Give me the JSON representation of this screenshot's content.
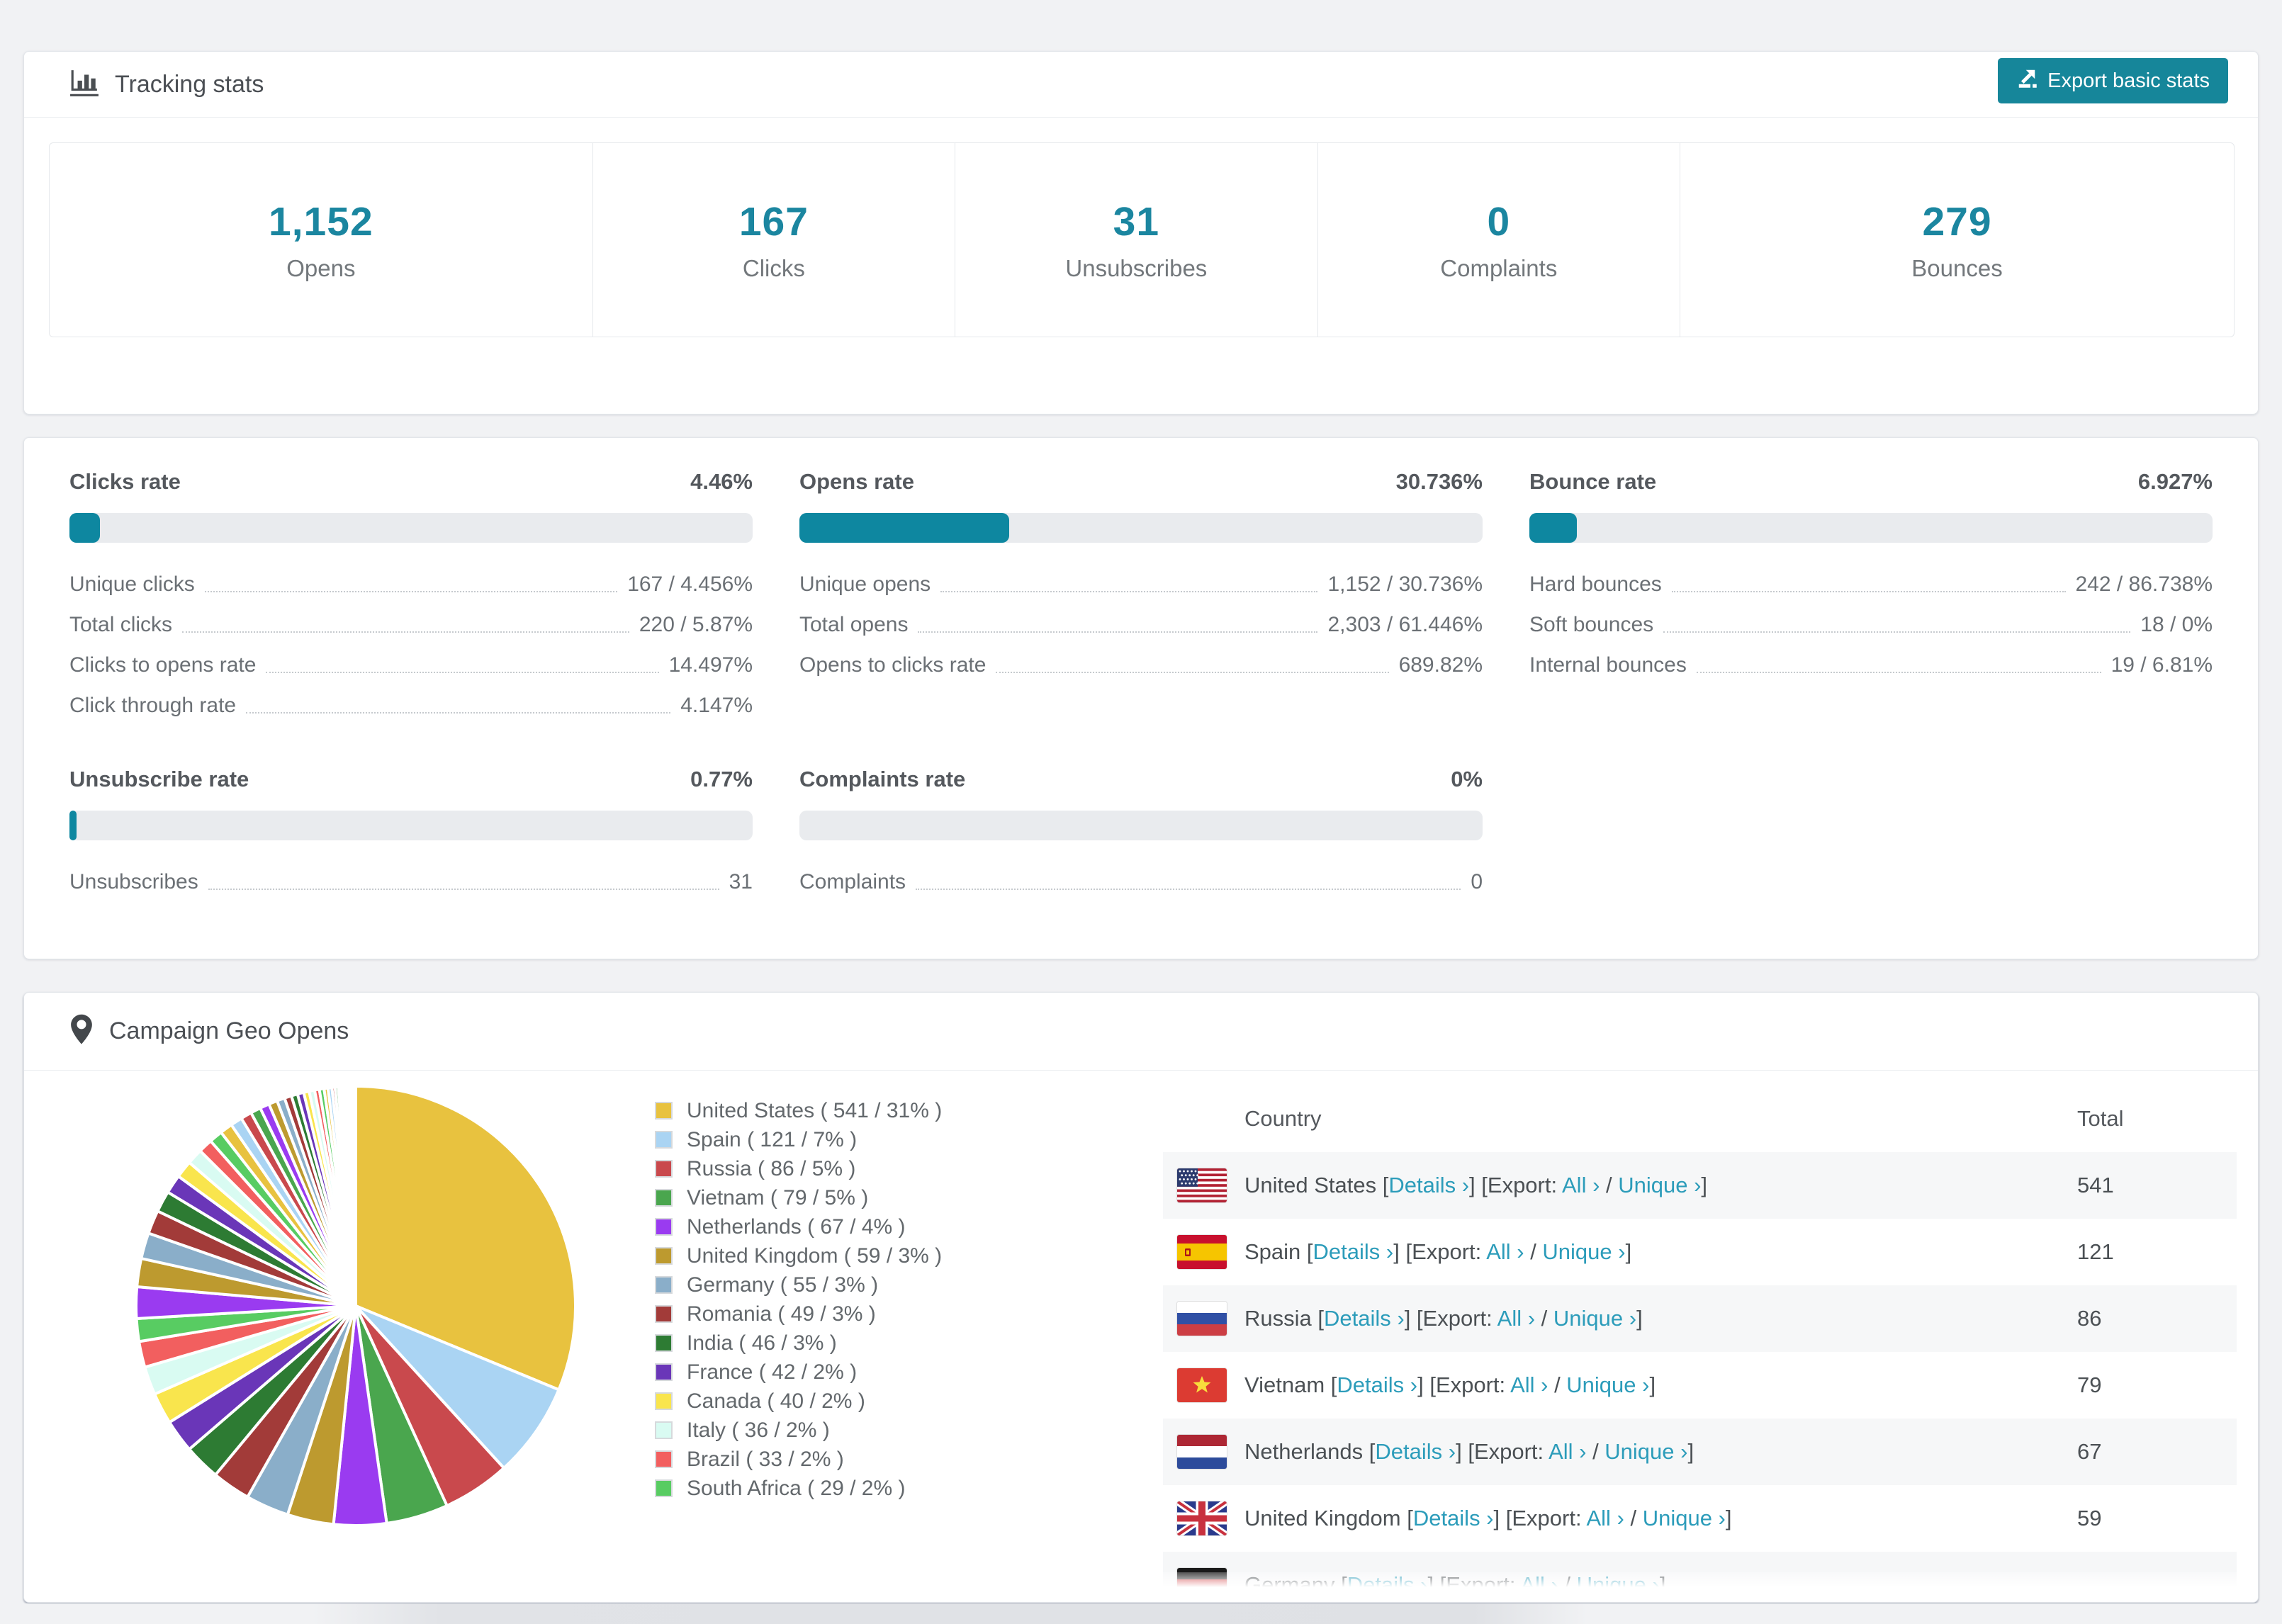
{
  "colors": {
    "accent": "#1b86a0",
    "accent_button": "#16869a",
    "bar_fill": "#0e87a0",
    "link": "#2c9cba"
  },
  "tracking": {
    "title": "Tracking stats",
    "export_button": "Export basic stats",
    "stats": [
      {
        "value": "1,152",
        "label": "Opens"
      },
      {
        "value": "167",
        "label": "Clicks"
      },
      {
        "value": "31",
        "label": "Unsubscribes"
      },
      {
        "value": "0",
        "label": "Complaints"
      },
      {
        "value": "279",
        "label": "Bounces"
      }
    ]
  },
  "rates": [
    {
      "title": "Clicks rate",
      "value": "4.46%",
      "bar_pct": 4.46,
      "rows": [
        {
          "label": "Unique clicks",
          "value": "167 / 4.456%"
        },
        {
          "label": "Total clicks",
          "value": "220 / 5.87%"
        },
        {
          "label": "Clicks to opens rate",
          "value": "14.497%"
        },
        {
          "label": "Click through rate",
          "value": "4.147%"
        }
      ]
    },
    {
      "title": "Opens rate",
      "value": "30.736%",
      "bar_pct": 30.736,
      "rows": [
        {
          "label": "Unique opens",
          "value": "1,152 / 30.736%"
        },
        {
          "label": "Total opens",
          "value": "2,303 / 61.446%"
        },
        {
          "label": "Opens to clicks rate",
          "value": "689.82%"
        }
      ]
    },
    {
      "title": "Bounce rate",
      "value": "6.927%",
      "bar_pct": 6.927,
      "rows": [
        {
          "label": "Hard bounces",
          "value": "242 / 86.738%"
        },
        {
          "label": "Soft bounces",
          "value": "18 / 0%"
        },
        {
          "label": "Internal bounces",
          "value": "19 / 6.81%"
        }
      ]
    },
    {
      "title": "Unsubscribe rate",
      "value": "0.77%",
      "bar_pct": 0.77,
      "rows": [
        {
          "label": "Unsubscribes",
          "value": "31"
        }
      ]
    },
    {
      "title": "Complaints rate",
      "value": "0%",
      "bar_pct": 0,
      "rows": [
        {
          "label": "Complaints",
          "value": "0"
        }
      ]
    }
  ],
  "geo": {
    "title": "Campaign Geo Opens",
    "table": {
      "headers": [
        "Country",
        "Total"
      ],
      "link_labels": {
        "details": "Details ›",
        "export_prefix": "Export:",
        "all": "All ›",
        "separator": "/",
        "unique": "Unique ›"
      },
      "rows": [
        {
          "country": "United States",
          "flag": "us",
          "total": "541"
        },
        {
          "country": "Spain",
          "flag": "es",
          "total": "121"
        },
        {
          "country": "Russia",
          "flag": "ru",
          "total": "86"
        },
        {
          "country": "Vietnam",
          "flag": "vn",
          "total": "79"
        },
        {
          "country": "Netherlands",
          "flag": "nl",
          "total": "67"
        },
        {
          "country": "United Kingdom",
          "flag": "gb",
          "total": "59"
        }
      ],
      "partial_row": {
        "country": "Germany",
        "flag": "de"
      }
    }
  },
  "chart_data": {
    "type": "pie",
    "title": "Campaign Geo Opens",
    "legend_position": "right",
    "series": [
      {
        "name": "United States",
        "value": 541,
        "pct": 31
      },
      {
        "name": "Spain",
        "value": 121,
        "pct": 7
      },
      {
        "name": "Russia",
        "value": 86,
        "pct": 5
      },
      {
        "name": "Vietnam",
        "value": 79,
        "pct": 5
      },
      {
        "name": "Netherlands",
        "value": 67,
        "pct": 4
      },
      {
        "name": "United Kingdom",
        "value": 59,
        "pct": 3
      },
      {
        "name": "Germany",
        "value": 55,
        "pct": 3
      },
      {
        "name": "Romania",
        "value": 49,
        "pct": 3
      },
      {
        "name": "India",
        "value": 46,
        "pct": 3
      },
      {
        "name": "France",
        "value": 42,
        "pct": 2
      },
      {
        "name": "Canada",
        "value": 40,
        "pct": 2
      },
      {
        "name": "Italy",
        "value": 36,
        "pct": 2
      },
      {
        "name": "Brazil",
        "value": 33,
        "pct": 2
      },
      {
        "name": "South Africa",
        "value": 29,
        "pct": 2
      }
    ],
    "other_unlabeled_slices": [
      40,
      36,
      33,
      30,
      27,
      24,
      22,
      20,
      18,
      17,
      16,
      15,
      14,
      13,
      12,
      11,
      10,
      9,
      8,
      8,
      7,
      7,
      6,
      6,
      5,
      5,
      4,
      4,
      3,
      3,
      3,
      2,
      2,
      2,
      2,
      1,
      1,
      1,
      1,
      1
    ],
    "palette": [
      "#e8c23f",
      "#aad4f3",
      "#c9494d",
      "#4aa64e",
      "#9a3bf0",
      "#bd9a2f",
      "#8aaec9",
      "#a23b39",
      "#2d7b33",
      "#6a36b8",
      "#f9e54d",
      "#d9fbf2",
      "#f25f5f",
      "#58cc62"
    ]
  }
}
